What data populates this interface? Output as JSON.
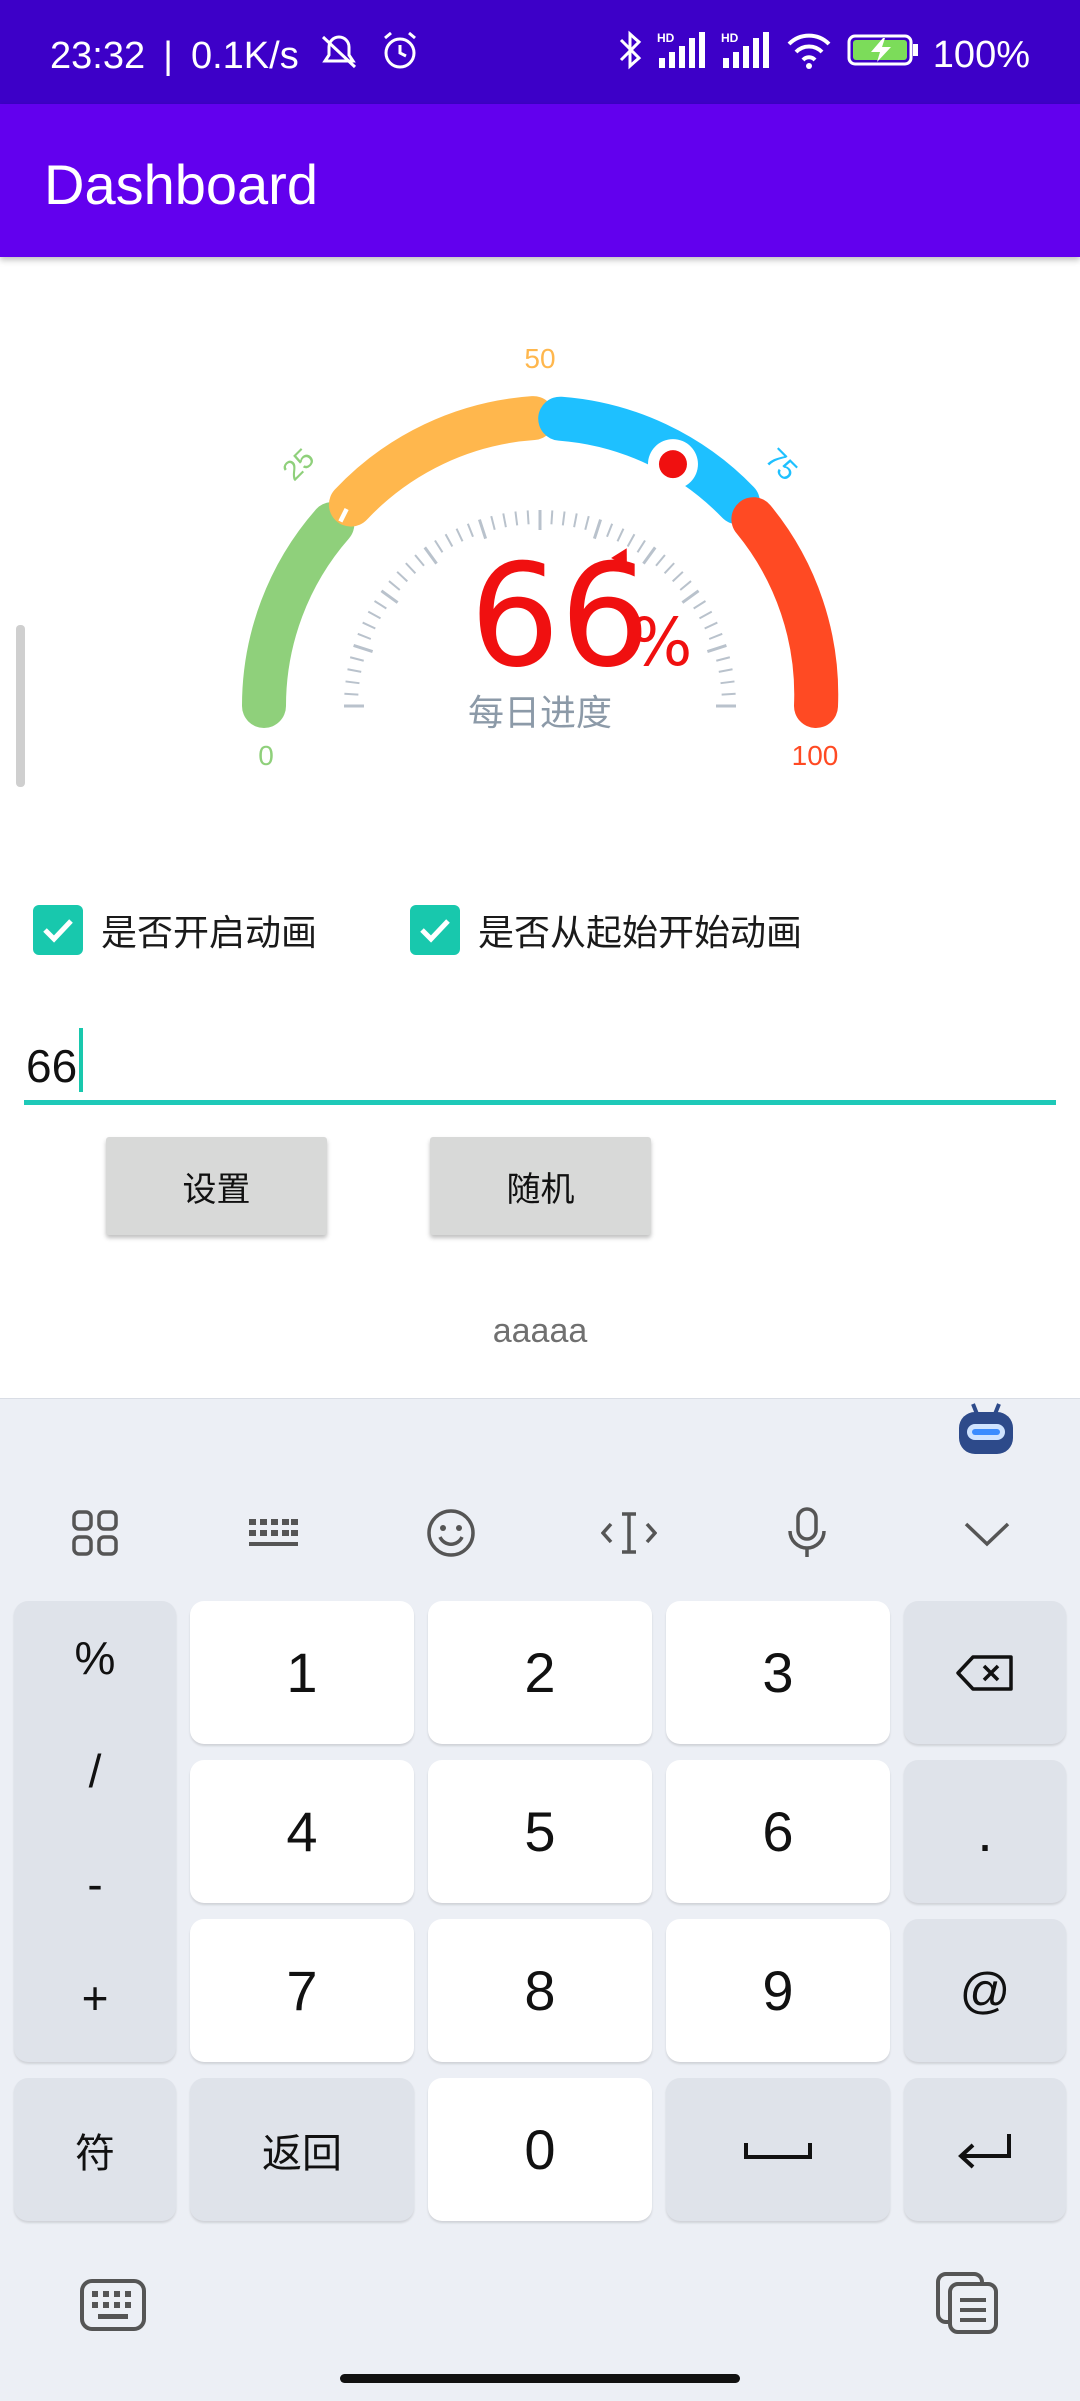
{
  "status_bar": {
    "time": "23:32",
    "net_speed": "0.1K/s",
    "battery": "100%",
    "icons": [
      "mute-icon",
      "alarm-icon",
      "bluetooth-icon",
      "signal-hd-icon",
      "signal-hd-icon",
      "wifi-icon",
      "battery-charging-icon"
    ]
  },
  "app_bar": {
    "title": "Dashboard"
  },
  "gauge": {
    "value": 66,
    "value_text": "66",
    "unit": "%",
    "caption": "每日进度",
    "tick_labels": [
      "0",
      "25",
      "50",
      "75",
      "100"
    ],
    "colors": {
      "seg0": "#8fd07b",
      "seg1": "#ffb74d",
      "seg2": "#1ec0ff",
      "seg3": "#ff4a23",
      "value": "#f01010"
    }
  },
  "checkboxes": [
    {
      "label": "是否开启动画",
      "checked": true
    },
    {
      "label": "是否从起始开始动画",
      "checked": true
    }
  ],
  "input": {
    "value": "66"
  },
  "buttons": {
    "set": "设置",
    "random": "随机"
  },
  "footer_text": "aaaaa",
  "keyboard": {
    "toolbar_icons": [
      "apps-grid-icon",
      "keyboard-layout-icon",
      "emoji-icon",
      "text-cursor-icon",
      "microphone-icon",
      "chevron-down-icon"
    ],
    "symbols": [
      "%",
      "/",
      "-",
      "+"
    ],
    "digits": [
      "1",
      "2",
      "3",
      "4",
      "5",
      "6",
      "7",
      "8",
      "9",
      "0"
    ],
    "period": ".",
    "at": "@",
    "symbol_key": "符",
    "back_key": "返回"
  }
}
